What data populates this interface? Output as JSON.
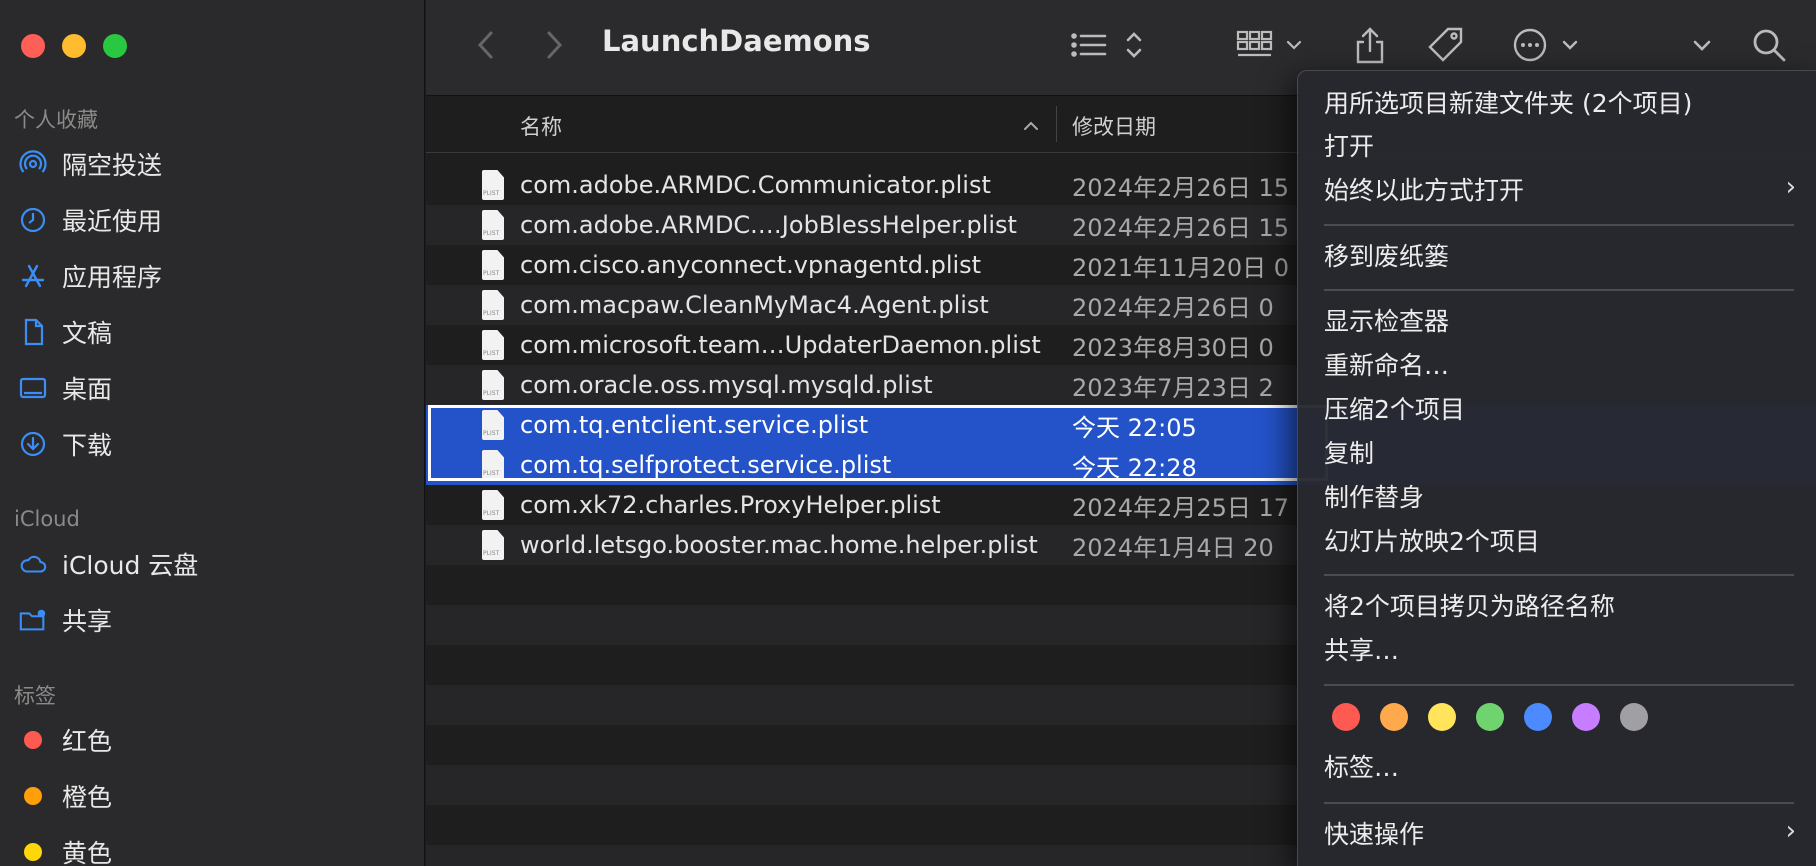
{
  "window": {
    "title": "LaunchDaemons"
  },
  "sidebar": {
    "favorites_label": "个人收藏",
    "favorites": [
      {
        "label": "隔空投送",
        "icon": "airdrop-icon"
      },
      {
        "label": "最近使用",
        "icon": "clock-icon"
      },
      {
        "label": "应用程序",
        "icon": "applications-icon"
      },
      {
        "label": "文稿",
        "icon": "document-icon"
      },
      {
        "label": "桌面",
        "icon": "desktop-icon"
      },
      {
        "label": "下载",
        "icon": "download-icon"
      }
    ],
    "icloud_label": "iCloud",
    "icloud": [
      {
        "label": "iCloud 云盘",
        "icon": "cloud-icon"
      },
      {
        "label": "共享",
        "icon": "shared-folder-icon"
      }
    ],
    "tags_label": "标签",
    "tags": [
      {
        "label": "红色",
        "color": "#ff5a52"
      },
      {
        "label": "橙色",
        "color": "#ff9f0a"
      },
      {
        "label": "黄色",
        "color": "#ffd60a"
      }
    ]
  },
  "columns": {
    "name": "名称",
    "date": "修改日期"
  },
  "files": [
    {
      "name": "com.adobe.ARMDC.Communicator.plist",
      "date": "2024年2月26日 15",
      "selected": false
    },
    {
      "name": "com.adobe.ARMDC.…JobBlessHelper.plist",
      "date": "2024年2月26日 15",
      "selected": false
    },
    {
      "name": "com.cisco.anyconnect.vpnagentd.plist",
      "date": "2021年11月20日 0",
      "selected": false
    },
    {
      "name": "com.macpaw.CleanMyMac4.Agent.plist",
      "date": "2024年2月26日 0",
      "selected": false
    },
    {
      "name": "com.microsoft.team…UpdaterDaemon.plist",
      "date": "2023年8月30日 0",
      "selected": false
    },
    {
      "name": "com.oracle.oss.mysql.mysqld.plist",
      "date": "2023年7月23日 2",
      "selected": false
    },
    {
      "name": "com.tq.entclient.service.plist",
      "date": "今天 22:05",
      "selected": true
    },
    {
      "name": "com.tq.selfprotect.service.plist",
      "date": "今天 22:28",
      "selected": true
    },
    {
      "name": "com.xk72.charles.ProxyHelper.plist",
      "date": "2024年2月25日 17",
      "selected": false
    },
    {
      "name": "world.letsgo.booster.mac.home.helper.plist",
      "date": "2024年1月4日 20",
      "selected": false
    }
  ],
  "context_menu": {
    "new_folder": "用所选项目新建文件夹 (2个项目)",
    "open": "打开",
    "open_with": "始终以此方式打开",
    "trash": "移到废纸篓",
    "inspector": "显示检查器",
    "rename": "重新命名…",
    "compress": "压缩2个项目",
    "copy": "复制",
    "alias": "制作替身",
    "slideshow": "幻灯片放映2个项目",
    "copy_path": "将2个项目拷贝为路径名称",
    "share": "共享…",
    "tag_colors": [
      "#ff5a52",
      "#ffa94d",
      "#ffe45c",
      "#6fd36f",
      "#4b8bff",
      "#c77dff",
      "#a0a0a4"
    ],
    "tags": "标签…",
    "quick_actions": "快速操作"
  }
}
